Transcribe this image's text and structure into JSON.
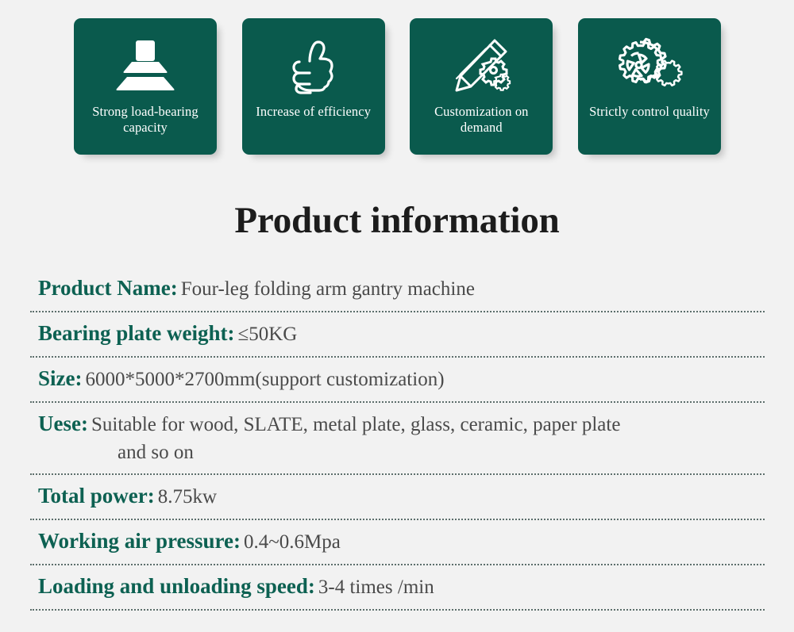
{
  "features": [
    {
      "icon": "stacked-load-icon",
      "label": "Strong load-bearing capacity"
    },
    {
      "icon": "thumbs-up-icon",
      "label": "Increase of efficiency"
    },
    {
      "icon": "pencil-gears-icon",
      "label": "Customization on demand"
    },
    {
      "icon": "double-gear-icon",
      "label": "Strictly control quality"
    }
  ],
  "section": {
    "title": "Product information"
  },
  "specs": [
    {
      "label": "Product Name:",
      "value": "Four-leg folding arm gantry machine",
      "value_line2": ""
    },
    {
      "label": "Bearing plate weight:",
      "value": "≤50KG",
      "value_line2": ""
    },
    {
      "label": "Size:",
      "value": "6000*5000*2700mm(support customization)",
      "value_line2": ""
    },
    {
      "label": "Uese:",
      "value": "Suitable for wood, SLATE, metal plate, glass, ceramic, paper plate",
      "value_line2": "and so on"
    },
    {
      "label": "Total power:",
      "value": "8.75kw",
      "value_line2": ""
    },
    {
      "label": "Working air pressure:",
      "value": "0.4~0.6Mpa",
      "value_line2": ""
    },
    {
      "label": "Loading and unloading speed:",
      "value": "3-4 times /min",
      "value_line2": ""
    }
  ],
  "colors": {
    "card_green": "#0a5a4d",
    "label_green": "#0d6152",
    "value_gray": "#4a4a4a",
    "background": "#f2f2f2",
    "title_black": "#1c1c1c",
    "divider": "#5c6e6b"
  }
}
